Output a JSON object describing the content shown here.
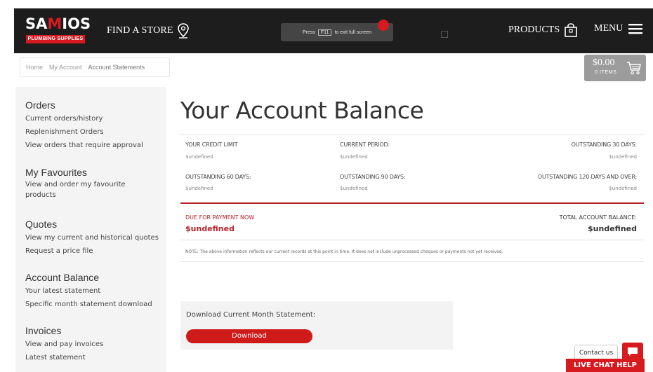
{
  "header": {
    "logo_text_pre": "SA",
    "logo_text_mark": "M",
    "logo_text_post": "IOS",
    "logo_tagline": "PLUMBING SUPPLIES",
    "find_store": "FIND A STORE",
    "fullscreen_prefix": "Press",
    "fullscreen_key": "F11",
    "fullscreen_suffix": "to exit full screen",
    "products": "PRODUCTS",
    "menu": "MENU"
  },
  "breadcrumb": {
    "items": [
      "Home",
      "My Account",
      "Account Statements"
    ]
  },
  "cart": {
    "amount": "$0.00",
    "items": "0 ITEMS"
  },
  "sidebar": {
    "groups": [
      {
        "heading": "Orders",
        "links": [
          "Current orders/history",
          "Replenishment Orders",
          "View orders that require approval"
        ]
      },
      {
        "heading": "My Favourites",
        "links": [
          "View and order my favourite products"
        ]
      },
      {
        "heading": "Quotes",
        "links": [
          "View my current and historical quotes",
          "Request a price file"
        ]
      },
      {
        "heading": "Account Balance",
        "links": [
          "Your latest statement",
          "Specific month statement download"
        ]
      },
      {
        "heading": "Invoices",
        "links": [
          "View and pay invoices",
          "Latest statement"
        ]
      }
    ]
  },
  "main": {
    "title": "Your Account Balance",
    "balances": [
      {
        "label": "YOUR CREDIT LIMIT",
        "value": "$undefined"
      },
      {
        "label": "CURRENT PERIOD:",
        "value": "$undefined"
      },
      {
        "label": "OUTSTANDING 30 DAYS:",
        "value": "$undefined"
      },
      {
        "label": "OUTSTANDING 60 DAYS:",
        "value": "$undefined"
      },
      {
        "label": "OUTSTANDING 90 DAYS:",
        "value": "$undefined"
      },
      {
        "label": "OUTSTANDING 120 DAYS AND OVER:",
        "value": "$undefined"
      }
    ],
    "due_label": "DUE FOR PAYMENT NOW",
    "due_value": "$undefined",
    "total_label": "TOTAL ACCOUNT BALANCE:",
    "total_value": "$undefined",
    "note": "NOTE: The above information reflects our current records at this point in time. It does not include unprocessed cheques or payments not yet received.",
    "download_title": "Download Current Month Statement:",
    "download_button": "Download"
  },
  "chat": {
    "contact": "Contact us",
    "live_chat": "LIVE CHAT HELP"
  },
  "colors": {
    "header_bg": "#1d1d1d",
    "brand_red": "#d71920",
    "sidebar_bg": "#f4f4f4"
  }
}
